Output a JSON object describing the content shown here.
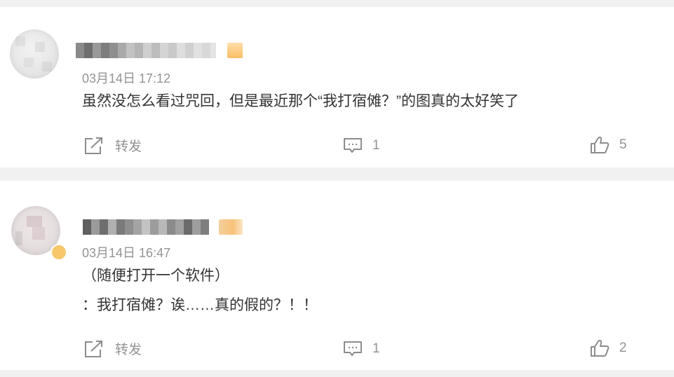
{
  "comments": [
    {
      "timestamp": "03月14日 17:12",
      "lines": [
        "虽然没怎么看过咒回，但是最近那个“我打宿傩？”的图真的太好笑了"
      ],
      "repost_label": "转发",
      "reply_count": "1",
      "like_count": "5"
    },
    {
      "timestamp": "03月14日 16:47",
      "lines": [
        "（随便打开一个软件）",
        "：我打宿傩？诶……真的假的？！！"
      ],
      "repost_label": "转发",
      "reply_count": "1",
      "like_count": "2"
    }
  ],
  "icons": {
    "repost": "share-out-icon",
    "reply": "comment-icon",
    "like": "thumbs-up-icon"
  },
  "colors": {
    "background": "#f1f1f1",
    "card": "#ffffff",
    "text": "#333333",
    "muted": "#939393",
    "level_tag": "#f9b44a"
  }
}
